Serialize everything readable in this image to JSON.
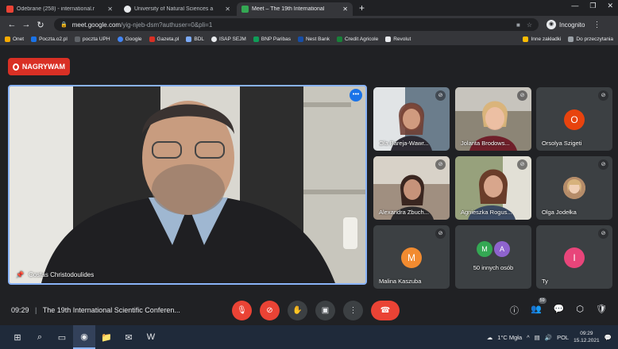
{
  "tabs": [
    {
      "title": "Odebrane (258) - international.r",
      "color": "#ea4335",
      "active": false
    },
    {
      "title": "University of Natural Sciences a",
      "color": "#e8eaed",
      "active": false
    },
    {
      "title": "Meet – The 19th International",
      "color": "#34a853",
      "active": true
    }
  ],
  "omnibox": {
    "host": "meet.google.com",
    "path": "/yig-njeb-dsm?authuser=0&pli=1"
  },
  "profile": {
    "label": "Incognito"
  },
  "bookmarks": [
    {
      "label": "Onet",
      "color": "#f9ab00"
    },
    {
      "label": "Poczta.o2.pl",
      "color": "#1a73e8"
    },
    {
      "label": "poczta UPH",
      "color": "#5f6368"
    },
    {
      "label": "Google",
      "color": "#4285f4"
    },
    {
      "label": "Gazeta.pl",
      "color": "#d93025"
    },
    {
      "label": "BDL",
      "color": "#7baaf7"
    },
    {
      "label": "ISAP SEJM",
      "color": "#e8eaed"
    },
    {
      "label": "BNP Paribas",
      "color": "#0f9d58"
    },
    {
      "label": "Nest Bank",
      "color": "#174ea6"
    },
    {
      "label": "Credit Agricole",
      "color": "#188038"
    },
    {
      "label": "Revolut",
      "color": "#e8eaed"
    }
  ],
  "bookmarks_right": [
    {
      "label": "Inne zakładki"
    },
    {
      "label": "Do przeczytania"
    }
  ],
  "recording": {
    "label": "NAGRYWAM"
  },
  "main_speaker": {
    "name": "Costas Christodoulides"
  },
  "participants": [
    {
      "name": "Ola Bareja-Wawr...",
      "kind": "video",
      "bg": "#6b7d8c"
    },
    {
      "name": "Jolanta Brodows...",
      "kind": "video",
      "bg": "#8c8576"
    },
    {
      "name": "Orsolya Szigeti",
      "kind": "avatar",
      "initial": "O",
      "color": "#e8430e"
    },
    {
      "name": "Alexandra Zbuch...",
      "kind": "video",
      "bg": "#a08f80"
    },
    {
      "name": "Agnieszka Rogus...",
      "kind": "video",
      "bg": "#97a17c"
    },
    {
      "name": "Olga Jodełka",
      "kind": "photo"
    },
    {
      "name": "Malina Kaszuba",
      "kind": "avatar",
      "initial": "M",
      "color": "#f28b30"
    },
    {
      "name": "50 innych osób",
      "kind": "group"
    },
    {
      "name": "Ty",
      "kind": "avatar",
      "initial": "I",
      "color": "#e8457a"
    }
  ],
  "group_avatars": [
    {
      "initial": "M",
      "color": "#34a853"
    },
    {
      "initial": "A",
      "color": "#8e63ce"
    }
  ],
  "meeting": {
    "time": "09:29",
    "separator": "|",
    "title": "The 19th International Scientific Conferen..."
  },
  "people_count": "59",
  "taskbar": {
    "weather": "1°C Mgła",
    "lang": "POL",
    "time": "09:29",
    "date": "15.12.2021"
  }
}
